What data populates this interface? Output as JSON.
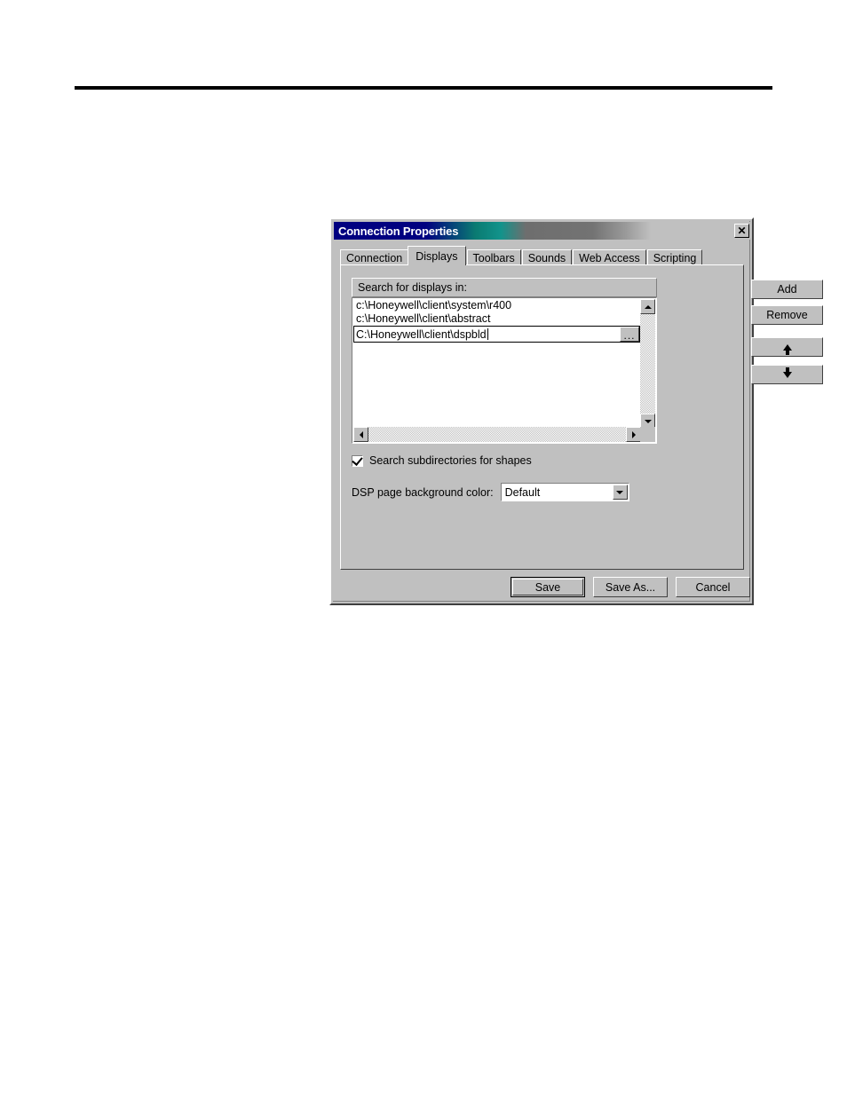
{
  "window": {
    "title_part1": "Connection",
    "title_part2": "Properties",
    "close_label": "✕"
  },
  "tabs": [
    {
      "label": "Connection",
      "active": false
    },
    {
      "label": "Displays",
      "active": true
    },
    {
      "label": "Toolbars",
      "active": false
    },
    {
      "label": "Sounds",
      "active": false
    },
    {
      "label": "Web Access",
      "active": false
    },
    {
      "label": "Scripting",
      "active": false
    }
  ],
  "displays_panel": {
    "search_label": "Search for displays in:",
    "list_items": [
      "c:\\Honeywell\\client\\system\\r400",
      "c:\\Honeywell\\client\\abstract"
    ],
    "editing_item": {
      "value": "C:\\Honeywell\\client\\dspbld",
      "browse_label": "..."
    },
    "checkbox": {
      "label": "Search subdirectories for shapes",
      "checked": true
    },
    "combo": {
      "label": "DSP page background color:",
      "value": "Default",
      "arrow_icon": "chevron-down-icon"
    },
    "side_buttons": [
      {
        "label": "Add",
        "icon": ""
      },
      {
        "label": "Remove",
        "icon": ""
      },
      {
        "label": "",
        "icon": "arrow-up-icon"
      },
      {
        "label": "",
        "icon": "arrow-down-icon"
      }
    ]
  },
  "footer_buttons": [
    {
      "label": "Save",
      "default": true
    },
    {
      "label": "Save As...",
      "default": false
    },
    {
      "label": "Cancel",
      "default": false
    }
  ],
  "colors": {
    "dialog_face": "#c0c0c0",
    "title_navy": "#000080",
    "title_teal": "#12938b",
    "field_bg": "#ffffff"
  }
}
